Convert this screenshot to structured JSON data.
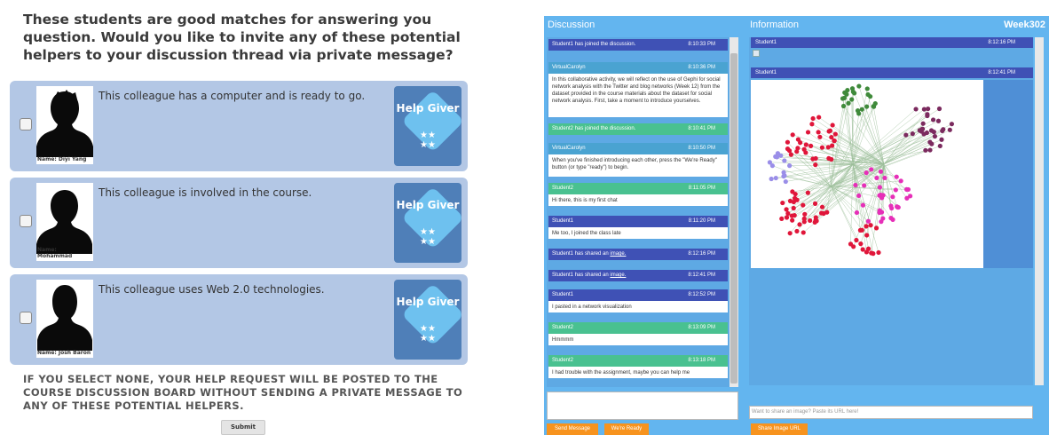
{
  "left": {
    "question": "These students are good matches for answering you question. Would you like to invite any of these potential helpers to your discussion thread via private message?",
    "badge_label": "Help Giver",
    "badge_stars": "★★\n★★",
    "candidates": [
      {
        "name": "Name: Diyi Yang",
        "description": "This colleague has a computer and is ready to go."
      },
      {
        "name": "Name: Mohammad",
        "description": "This colleague is involved in the course."
      },
      {
        "name": "Name: Josh Baron",
        "description": "This colleague uses Web 2.0 technologies."
      }
    ],
    "footer_note": "IF YOU SELECT NONE, YOUR HELP REQUEST WILL BE POSTED TO THE COURSE DISCUSSION BOARD WITHOUT SENDING A PRIVATE MESSAGE TO ANY OF THESE POTENTIAL HELPERS.",
    "submit_label": "Submit"
  },
  "right": {
    "discussion_title": "Discussion",
    "information_title": "Information",
    "week_label": "Week302",
    "messages": [
      {
        "header": "Student1 has joined the discussion.",
        "time": "8:10:33 PM",
        "color": "#3f51b5",
        "body": ""
      },
      {
        "header": "VirtualCarolyn",
        "time": "8:10:36 PM",
        "color": "#4aa3d1",
        "body": "In this collaborative activity, we will reflect on the use of Gephi for social network analysis with the Twitter and blog networks (Week 12) from the dataset provided in the course materials about the dataset for social network analysis. First, take a moment to introduce yourselves."
      },
      {
        "header": "Student2 has joined the discussion.",
        "time": "8:10:41 PM",
        "color": "#49c190",
        "body": ""
      },
      {
        "header": "VirtualCarolyn",
        "time": "8:10:50 PM",
        "color": "#4aa3d1",
        "body": "When you've finished introducing each other, press the \"We're Ready\" button (or type \"ready\") to begin."
      },
      {
        "header": "Student2",
        "time": "8:11:05 PM",
        "color": "#49c190",
        "body": "Hi there, this is my first chat"
      },
      {
        "header": "Student1",
        "time": "8:11:20 PM",
        "color": "#3f51b5",
        "body": "Me too, I joined the class late"
      },
      {
        "header": "Student1 has shared an",
        "link": "image.",
        "time": "8:12:16 PM",
        "color": "#3f51b5",
        "body": ""
      },
      {
        "header": "Student1 has shared an",
        "link": "image.",
        "time": "8:12:41 PM",
        "color": "#3f51b5",
        "body": ""
      },
      {
        "header": "Student1",
        "time": "8:12:52 PM",
        "color": "#3f51b5",
        "body": "I pasted in a network visualization"
      },
      {
        "header": "Student2",
        "time": "8:13:09 PM",
        "color": "#49c190",
        "body": "Hmmmm"
      },
      {
        "header": "Student2",
        "time": "8:13:18 PM",
        "color": "#49c190",
        "body": "I had trouble with the assignment, maybe you can help me"
      }
    ],
    "send_label": "Send Message",
    "ready_label": "We're Ready",
    "info_items": [
      {
        "header": "Student1",
        "time": "8:12:16 PM"
      },
      {
        "header": "Student1",
        "time": "8:12:41 PM"
      }
    ],
    "image_url_placeholder": "Want to share an image? Paste its URL here!",
    "share_label": "Share Image URL"
  },
  "colors": {
    "card_bg": "#b3c7e5",
    "badge_bg": "#4f7fb8",
    "panel_bg": "#63b5ef",
    "purple": "#3f51b5",
    "green": "#49c190",
    "orange": "#f7931e"
  }
}
